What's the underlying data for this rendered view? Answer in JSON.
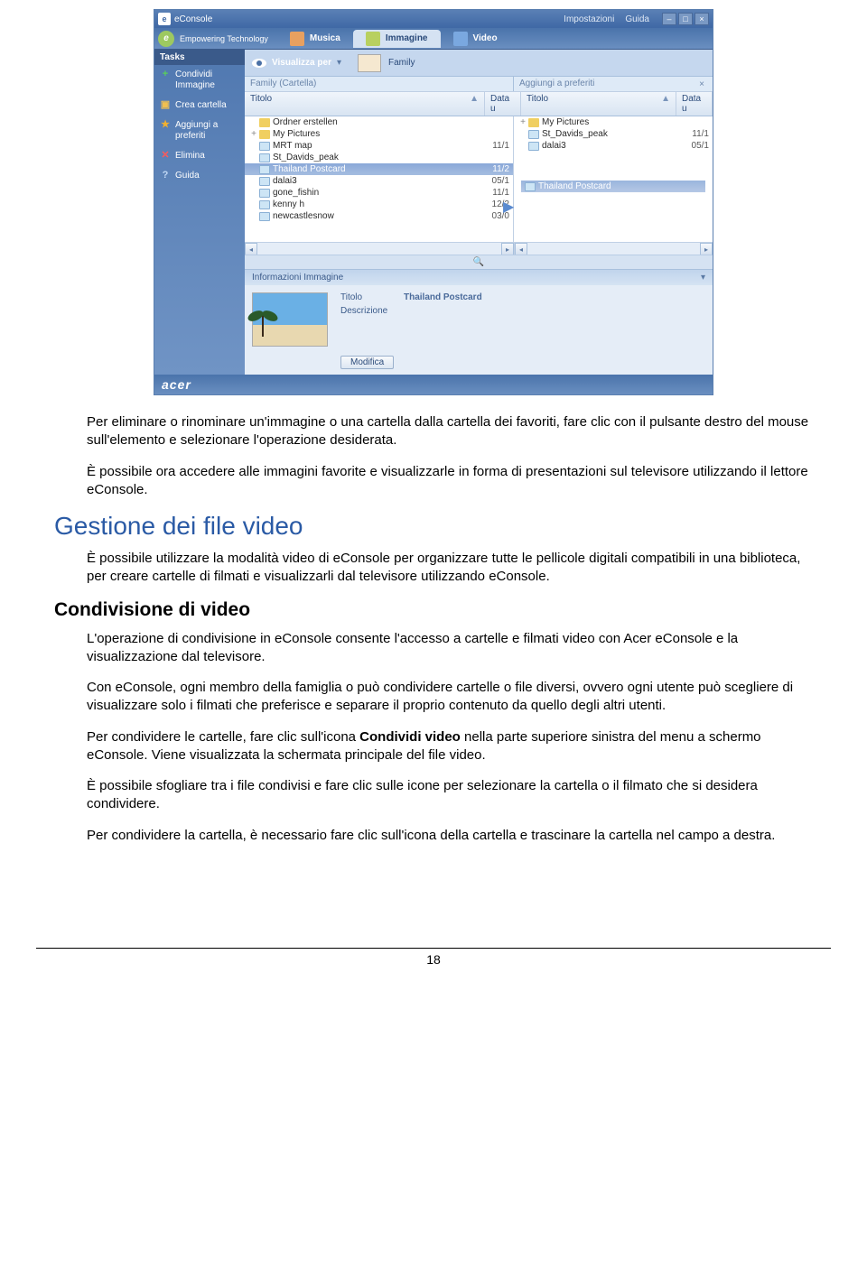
{
  "app": {
    "title": "eConsole",
    "impostazioni": "Impostazioni",
    "guida": "Guida",
    "empowering": "Empowering Technology",
    "tabs": {
      "musica": "Musica",
      "immagine": "Immagine",
      "video": "Video"
    },
    "sidebar": {
      "header": "Tasks",
      "items": [
        {
          "icon": "plus",
          "label": "Condividi Immagine"
        },
        {
          "icon": "folder",
          "label": "Crea cartella"
        },
        {
          "icon": "star",
          "label": "Aggiungi a preferiti"
        },
        {
          "icon": "x",
          "label": "Elimina"
        },
        {
          "icon": "q",
          "label": "Guida"
        }
      ]
    },
    "viewbar": {
      "label": "Visualizza per",
      "thumb": "Family"
    },
    "breadcrumb": {
      "left": "Family (Cartella)",
      "right": "Aggiungi a preferiti"
    },
    "columns": {
      "titolo": "Titolo",
      "data": "Data u"
    },
    "left_list": [
      {
        "toggle": "",
        "type": "folder",
        "name": "Ordner erstellen",
        "date": ""
      },
      {
        "toggle": "+",
        "type": "folder",
        "name": "My Pictures",
        "date": ""
      },
      {
        "toggle": "",
        "type": "img",
        "name": "MRT map",
        "date": "11/1"
      },
      {
        "toggle": "",
        "type": "img",
        "name": "St_Davids_peak",
        "date": ""
      },
      {
        "toggle": "",
        "type": "img",
        "name": "Thailand Postcard",
        "date": "11/2",
        "selected": true
      },
      {
        "toggle": "",
        "type": "img",
        "name": "dalai3",
        "date": "05/1"
      },
      {
        "toggle": "",
        "type": "img",
        "name": "gone_fishin",
        "date": "11/1"
      },
      {
        "toggle": "",
        "type": "img",
        "name": "kenny h",
        "date": "12/2"
      },
      {
        "toggle": "",
        "type": "img",
        "name": "newcastlesnow",
        "date": "03/0"
      }
    ],
    "right_list": [
      {
        "toggle": "+",
        "type": "folder",
        "name": "My Pictures",
        "date": ""
      },
      {
        "toggle": "",
        "type": "img",
        "name": "St_Davids_peak",
        "date": "11/1"
      },
      {
        "toggle": "",
        "type": "img",
        "name": "dalai3",
        "date": "05/1"
      }
    ],
    "drag_ghost": "Thailand Postcard",
    "info": {
      "header": "Informazioni Immagine",
      "titolo_label": "Titolo",
      "titolo_value": "Thailand Postcard",
      "descr_label": "Descrizione",
      "modifica": "Modifica"
    },
    "logo": "acer"
  },
  "doc": {
    "p1": "Per eliminare o rinominare un'immagine o una cartella dalla cartella dei favoriti, fare clic con il pulsante destro del mouse sull'elemento e selezionare l'operazione desiderata.",
    "p2": "È possibile ora accedere alle immagini favorite e visualizzarle in forma di presentazioni sul televisore utilizzando il lettore eConsole.",
    "h1": "Gestione dei file video",
    "p3": "È possibile utilizzare la modalità video di eConsole per organizzare tutte le pellicole digitali compatibili in una biblioteca, per creare cartelle di filmati e visualizzarli dal televisore utilizzando eConsole.",
    "h2": "Condivisione di video",
    "p4": "L'operazione di condivisione in eConsole consente l'accesso a cartelle e filmati video con Acer eConsole e la visualizzazione dal televisore.",
    "p5": "Con eConsole, ogni membro della famiglia o può condividere cartelle o file diversi, ovvero ogni utente può scegliere di visualizzare solo i filmati che preferisce e separare il proprio contenuto da quello degli altri utenti.",
    "p6a": "Per condividere le cartelle, fare clic sull'icona ",
    "p6b": "Condividi video",
    "p6c": " nella parte superiore sinistra del menu a schermo eConsole. Viene visualizzata la schermata principale del file video.",
    "p7": "È possibile sfogliare tra i file condivisi e fare clic sulle icone per selezionare la cartella o il filmato che si desidera condividere.",
    "p8": "Per condividere la cartella, è necessario fare clic sull'icona della cartella e trascinare la cartella nel campo a destra.",
    "pagenum": "18"
  }
}
